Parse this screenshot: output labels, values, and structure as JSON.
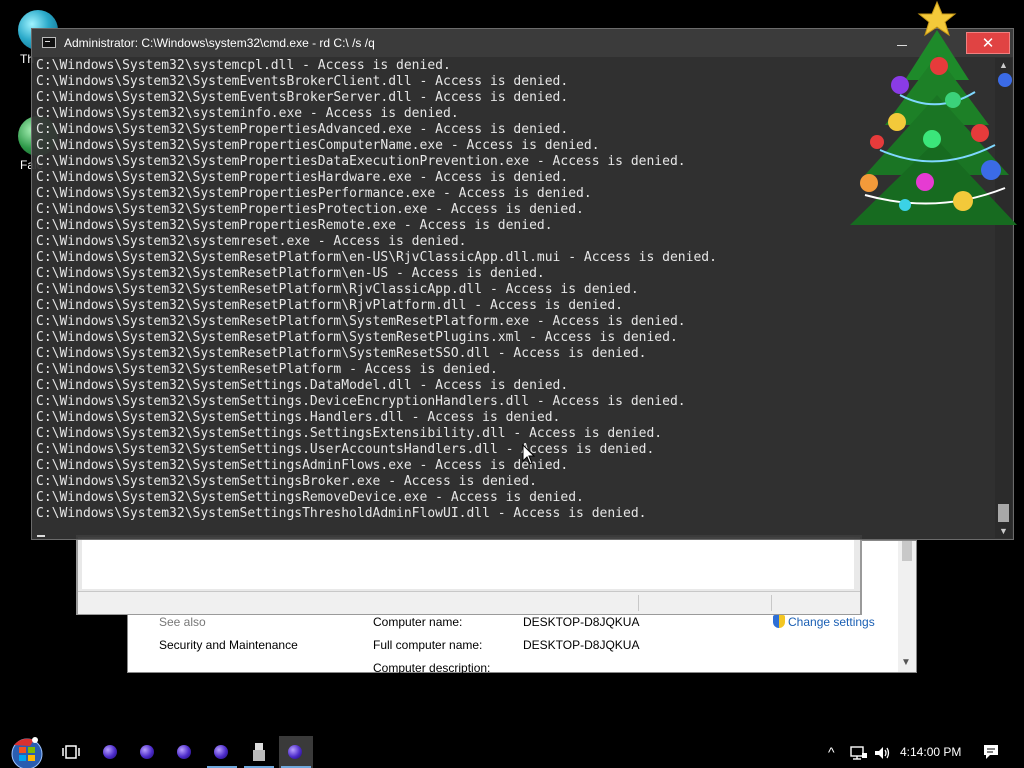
{
  "desktop": {
    "icons": [
      {
        "label": "Th",
        "icon": "desktop-app-icon"
      },
      {
        "label": "Falc",
        "icon": "desktop-app-icon"
      }
    ]
  },
  "system_window": {
    "see_also_label": "See also",
    "security_link": "Security and Maintenance",
    "computer_name_label": "Computer name:",
    "computer_name_value": "DESKTOP-D8JQKUA",
    "full_computer_name_label": "Full computer name:",
    "full_computer_name_value": "DESKTOP-D8JQKUA",
    "computer_description_label": "Computer description:",
    "change_settings_link": "Change settings"
  },
  "cmd": {
    "title": "Administrator: C:\\Windows\\system32\\cmd.exe - rd  C:\\ /s /q",
    "close_glyph": "✕",
    "lines": [
      "C:\\Windows\\System32\\systemcpl.dll - Access is denied.",
      "C:\\Windows\\System32\\SystemEventsBrokerClient.dll - Access is denied.",
      "C:\\Windows\\System32\\SystemEventsBrokerServer.dll - Access is denied.",
      "C:\\Windows\\System32\\systeminfo.exe - Access is denied.",
      "C:\\Windows\\System32\\SystemPropertiesAdvanced.exe - Access is denied.",
      "C:\\Windows\\System32\\SystemPropertiesComputerName.exe - Access is denied.",
      "C:\\Windows\\System32\\SystemPropertiesDataExecutionPrevention.exe - Access is denied.",
      "C:\\Windows\\System32\\SystemPropertiesHardware.exe - Access is denied.",
      "C:\\Windows\\System32\\SystemPropertiesPerformance.exe - Access is denied.",
      "C:\\Windows\\System32\\SystemPropertiesProtection.exe - Access is denied.",
      "C:\\Windows\\System32\\SystemPropertiesRemote.exe - Access is denied.",
      "C:\\Windows\\System32\\systemreset.exe - Access is denied.",
      "C:\\Windows\\System32\\SystemResetPlatform\\en-US\\RjvClassicApp.dll.mui - Access is denied.",
      "C:\\Windows\\System32\\SystemResetPlatform\\en-US - Access is denied.",
      "C:\\Windows\\System32\\SystemResetPlatform\\RjvClassicApp.dll - Access is denied.",
      "C:\\Windows\\System32\\SystemResetPlatform\\RjvPlatform.dll - Access is denied.",
      "C:\\Windows\\System32\\SystemResetPlatform\\SystemResetPlatform.exe - Access is denied.",
      "C:\\Windows\\System32\\SystemResetPlatform\\SystemResetPlugins.xml - Access is denied.",
      "C:\\Windows\\System32\\SystemResetPlatform\\SystemResetSSO.dll - Access is denied.",
      "C:\\Windows\\System32\\SystemResetPlatform - Access is denied.",
      "C:\\Windows\\System32\\SystemSettings.DataModel.dll - Access is denied.",
      "C:\\Windows\\System32\\SystemSettings.DeviceEncryptionHandlers.dll - Access is denied.",
      "C:\\Windows\\System32\\SystemSettings.Handlers.dll - Access is denied.",
      "C:\\Windows\\System32\\SystemSettings.SettingsExtensibility.dll - Access is denied.",
      "C:\\Windows\\System32\\SystemSettings.UserAccountsHandlers.dll - Access is denied.",
      "C:\\Windows\\System32\\SystemSettingsAdminFlows.exe - Access is denied.",
      "C:\\Windows\\System32\\SystemSettingsBroker.exe - Access is denied.",
      "C:\\Windows\\System32\\SystemSettingsRemoveDevice.exe - Access is denied.",
      "C:\\Windows\\System32\\SystemSettingsThresholdAdminFlowUI.dll - Access is denied."
    ]
  },
  "taskbar": {
    "apps": [
      {
        "icon": "app-orb-icon",
        "active": false
      },
      {
        "icon": "app-orb-icon",
        "active": false
      },
      {
        "icon": "app-orb-icon",
        "active": false
      },
      {
        "icon": "app-orb-icon",
        "active": false
      },
      {
        "icon": "usb-drive-icon",
        "active": false
      },
      {
        "icon": "app-orb-icon",
        "active": true
      }
    ],
    "tray": {
      "chevron": "^",
      "clock": "4:14:00 PM"
    }
  },
  "colors": {
    "cmd_background": "#343434",
    "close_button": "#e04343",
    "link": "#1a5fb4",
    "taskbar": "#000000"
  }
}
